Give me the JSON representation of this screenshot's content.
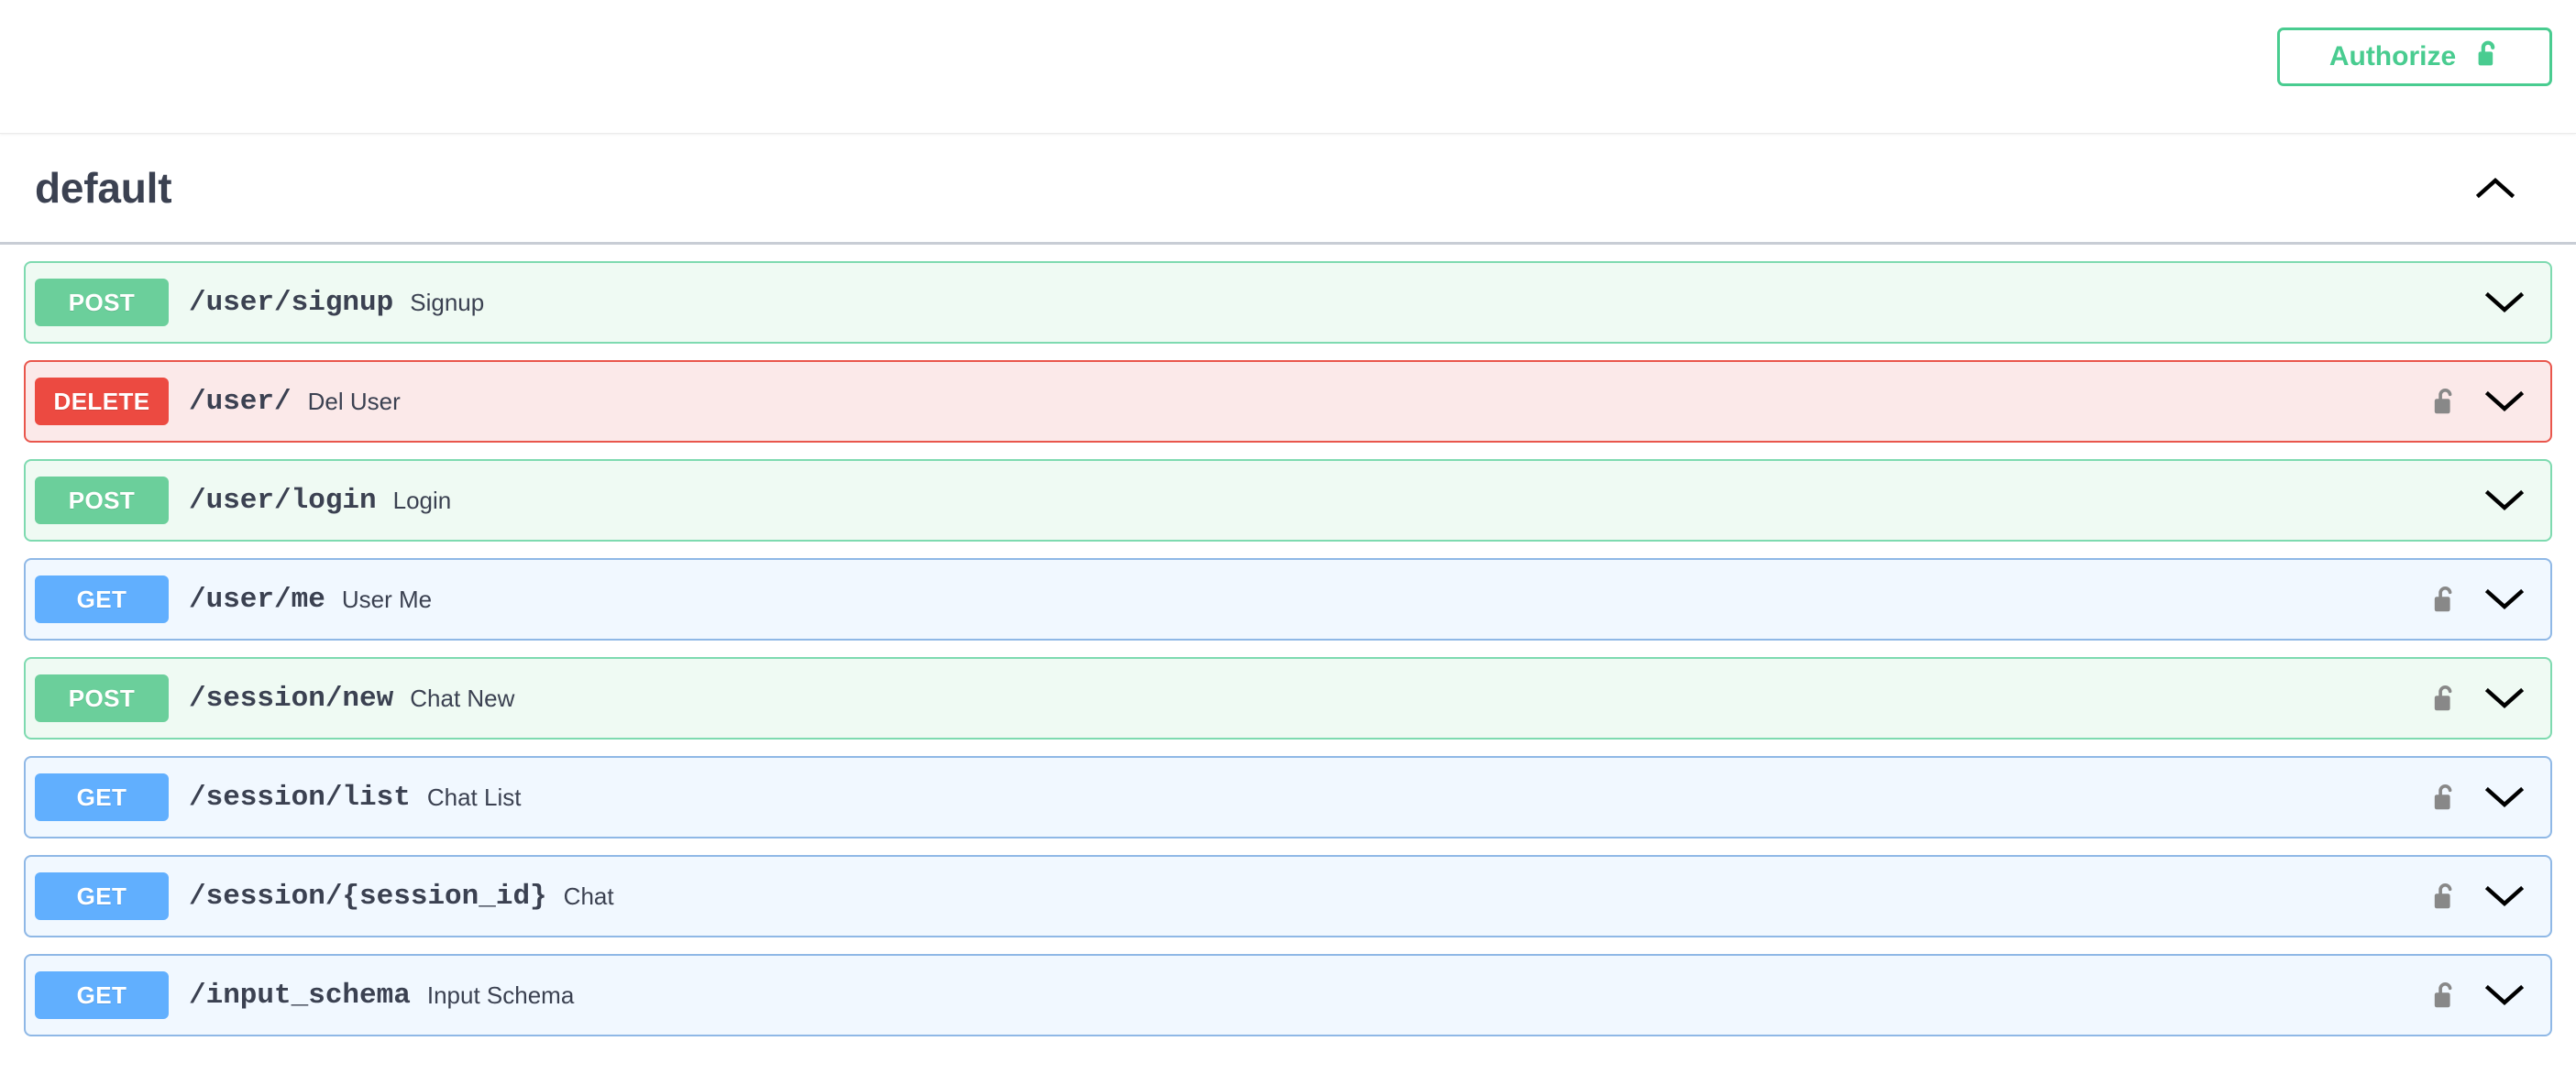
{
  "authorize": {
    "label": "Authorize",
    "icon": "unlock-icon",
    "border_color": "#49cc90",
    "text_color": "#49cc90"
  },
  "tag": {
    "name": "default",
    "expanded": true,
    "toggle_icon": "chevron-up-icon"
  },
  "colors": {
    "get": "#61affe",
    "get_bg": "#f1f8ff",
    "get_border": "#8fb8e6",
    "post": "#6bcf9b",
    "post_bg": "#effaf3",
    "post_border": "#7edab0",
    "delete": "#ec4a41",
    "delete_bg": "#fbe9e9",
    "delete_border": "#e9564c",
    "text": "#3b4151",
    "lock": "#888888"
  },
  "operations": [
    {
      "method": "POST",
      "path": "/user/signup",
      "summary": "Signup",
      "locked": false,
      "toggle_icon": "chevron-down-icon"
    },
    {
      "method": "DELETE",
      "path": "/user/",
      "summary": "Del User",
      "locked": true,
      "lock_icon": "unlock-icon",
      "toggle_icon": "chevron-down-icon"
    },
    {
      "method": "POST",
      "path": "/user/login",
      "summary": "Login",
      "locked": false,
      "toggle_icon": "chevron-down-icon"
    },
    {
      "method": "GET",
      "path": "/user/me",
      "summary": "User Me",
      "locked": true,
      "lock_icon": "unlock-icon",
      "toggle_icon": "chevron-down-icon"
    },
    {
      "method": "POST",
      "path": "/session/new",
      "summary": "Chat New",
      "locked": true,
      "lock_icon": "unlock-icon",
      "toggle_icon": "chevron-down-icon"
    },
    {
      "method": "GET",
      "path": "/session/list",
      "summary": "Chat List",
      "locked": true,
      "lock_icon": "unlock-icon",
      "toggle_icon": "chevron-down-icon"
    },
    {
      "method": "GET",
      "path": "/session/{session_id}",
      "summary": "Chat",
      "locked": true,
      "lock_icon": "unlock-icon",
      "toggle_icon": "chevron-down-icon"
    },
    {
      "method": "GET",
      "path": "/input_schema",
      "summary": "Input Schema",
      "locked": true,
      "lock_icon": "unlock-icon",
      "toggle_icon": "chevron-down-icon"
    }
  ]
}
